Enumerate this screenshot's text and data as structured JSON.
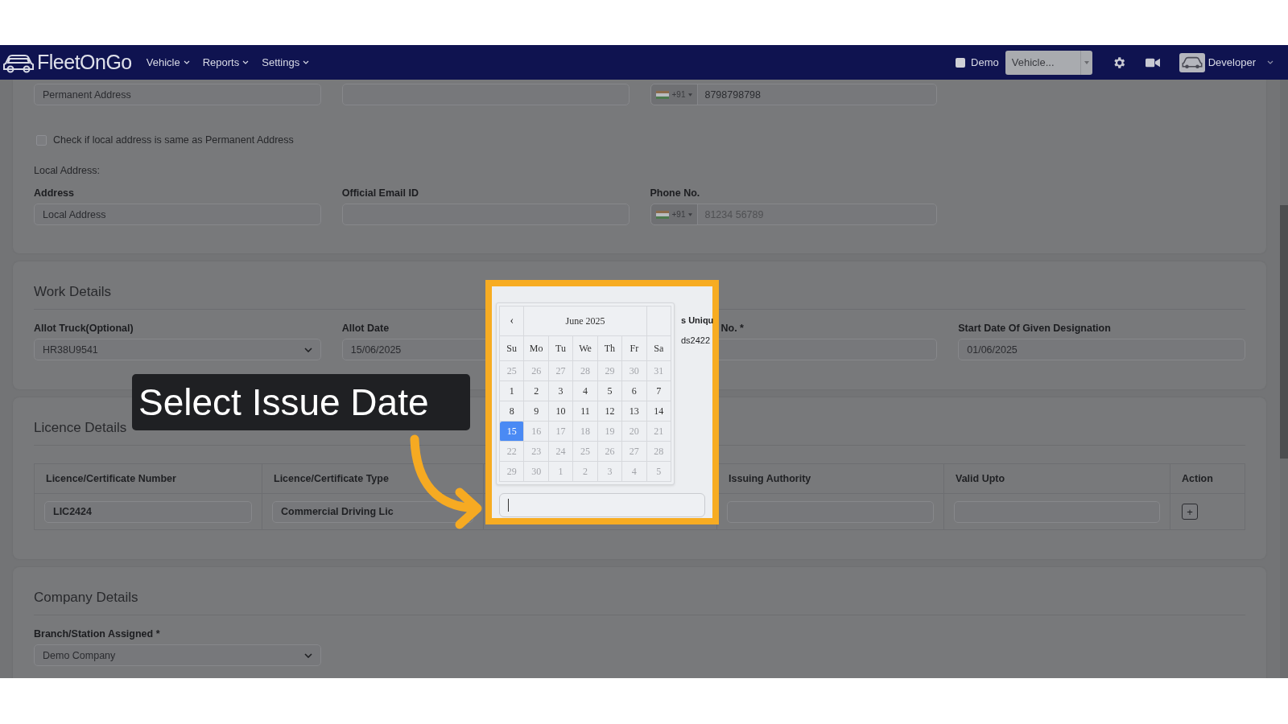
{
  "navbar": {
    "brand": "FleetOnGo",
    "menus": [
      {
        "label": "Vehicle"
      },
      {
        "label": "Reports"
      },
      {
        "label": "Settings"
      }
    ],
    "demo": {
      "label": "Demo",
      "checked": false
    },
    "vehicle_select": {
      "value": "Vehicle..."
    },
    "user": {
      "name": "Developer"
    }
  },
  "personal": {
    "row1": [
      {
        "kind": "text",
        "value": "Permanent Address"
      },
      {
        "kind": "text"
      },
      {
        "kind": "phone",
        "code": "+91",
        "value": "8798798798"
      }
    ],
    "same_address": {
      "label": "Check if local address is same as Permanent Address",
      "checked": false
    },
    "local_heading": "Local Address:",
    "row2": [
      {
        "kind": "text",
        "label": "Address",
        "value": "Local Address"
      },
      {
        "kind": "text",
        "label": "Official Email ID"
      },
      {
        "kind": "phone",
        "label": "Phone No.",
        "code": "+91",
        "placeholder": "81234 56789"
      }
    ]
  },
  "work": {
    "title": "Work Details",
    "fields": [
      {
        "kind": "select",
        "label": "Allot Truck(Optional)",
        "value": "HR38U9541"
      },
      {
        "kind": "text",
        "label": "Allot Date",
        "value": "15/06/2025"
      },
      {
        "kind": "covered",
        "label": "No. *"
      },
      {
        "kind": "text",
        "label": "Start Date Of Given Designation",
        "value": "01/06/2025"
      }
    ]
  },
  "licence": {
    "title": "Licence Details",
    "columns": [
      {
        "label": "Licence/Certificate Number"
      },
      {
        "label": "Licence/Certificate Type"
      },
      {},
      {
        "label": "Issuing Authority"
      },
      {
        "label": "Valid Upto"
      },
      {
        "label": "Action"
      }
    ],
    "rows": [
      {
        "cells": [
          {
            "kind": "input",
            "value": "LIC2424"
          },
          {
            "kind": "input",
            "value": "Commercial Driving Lic"
          },
          {
            "kind": "covered"
          },
          {
            "kind": "input"
          },
          {
            "kind": "input"
          },
          {
            "kind": "button",
            "label": "+"
          }
        ]
      }
    ]
  },
  "company": {
    "title": "Company Details",
    "fields": [
      {
        "kind": "select",
        "label": "Branch/Station Assigned *",
        "value": "Demo Company"
      }
    ]
  },
  "overlay": {
    "callout": "Select Issue Date",
    "behind": {
      "label_fragment": "s Uniqu",
      "value_fragment": "ds2422"
    },
    "calendar": {
      "prev": "‹",
      "title": "June 2025",
      "weekdays": [
        "Su",
        "Mo",
        "Tu",
        "We",
        "Th",
        "Fr",
        "Sa"
      ],
      "weeks": [
        [
          {
            "day": "25",
            "disabled": true,
            "selected": false
          },
          {
            "day": "26",
            "disabled": true,
            "selected": false
          },
          {
            "day": "27",
            "disabled": true,
            "selected": false
          },
          {
            "day": "28",
            "disabled": true,
            "selected": false
          },
          {
            "day": "29",
            "disabled": true,
            "selected": false
          },
          {
            "day": "30",
            "disabled": true,
            "selected": false
          },
          {
            "day": "31",
            "disabled": true,
            "selected": false
          }
        ],
        [
          {
            "day": "1",
            "disabled": false,
            "selected": false
          },
          {
            "day": "2",
            "disabled": false,
            "selected": false
          },
          {
            "day": "3",
            "disabled": false,
            "selected": false
          },
          {
            "day": "4",
            "disabled": false,
            "selected": false
          },
          {
            "day": "5",
            "disabled": false,
            "selected": false
          },
          {
            "day": "6",
            "disabled": false,
            "selected": false
          },
          {
            "day": "7",
            "disabled": false,
            "selected": false
          }
        ],
        [
          {
            "day": "8",
            "disabled": false,
            "selected": false
          },
          {
            "day": "9",
            "disabled": false,
            "selected": false
          },
          {
            "day": "10",
            "disabled": false,
            "selected": false
          },
          {
            "day": "11",
            "disabled": false,
            "selected": false
          },
          {
            "day": "12",
            "disabled": false,
            "selected": false
          },
          {
            "day": "13",
            "disabled": false,
            "selected": false
          },
          {
            "day": "14",
            "disabled": false,
            "selected": false
          }
        ],
        [
          {
            "day": "15",
            "disabled": false,
            "selected": true
          },
          {
            "day": "16",
            "disabled": true,
            "selected": false
          },
          {
            "day": "17",
            "disabled": true,
            "selected": false
          },
          {
            "day": "18",
            "disabled": true,
            "selected": false
          },
          {
            "day": "19",
            "disabled": true,
            "selected": false
          },
          {
            "day": "20",
            "disabled": true,
            "selected": false
          },
          {
            "day": "21",
            "disabled": true,
            "selected": false
          }
        ],
        [
          {
            "day": "22",
            "disabled": true,
            "selected": false
          },
          {
            "day": "23",
            "disabled": true,
            "selected": false
          },
          {
            "day": "24",
            "disabled": true,
            "selected": false
          },
          {
            "day": "25",
            "disabled": true,
            "selected": false
          },
          {
            "day": "26",
            "disabled": true,
            "selected": false
          },
          {
            "day": "27",
            "disabled": true,
            "selected": false
          },
          {
            "day": "28",
            "disabled": true,
            "selected": false
          }
        ],
        [
          {
            "day": "29",
            "disabled": true,
            "selected": false
          },
          {
            "day": "30",
            "disabled": true,
            "selected": false
          },
          {
            "day": "1",
            "disabled": true,
            "selected": false
          },
          {
            "day": "2",
            "disabled": true,
            "selected": false
          },
          {
            "day": "3",
            "disabled": true,
            "selected": false
          },
          {
            "day": "4",
            "disabled": true,
            "selected": false
          },
          {
            "day": "5",
            "disabled": true,
            "selected": false
          }
        ]
      ]
    }
  }
}
